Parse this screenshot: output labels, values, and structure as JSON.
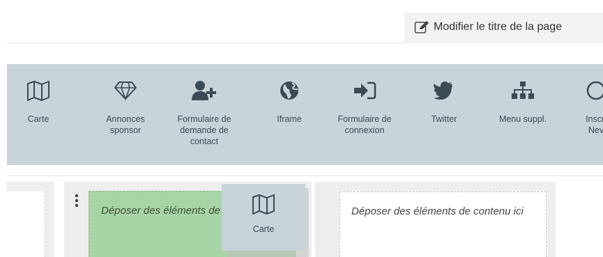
{
  "header": {
    "edit_title_label": "Modifier le titre de la page",
    "edit_icon": "edit-icon"
  },
  "widgets": [
    {
      "label": "Carte",
      "icon": "map-icon"
    },
    {
      "label": "Annonces sponsor",
      "icon": "diamond-icon"
    },
    {
      "label": "Formulaire de demande de contact",
      "icon": "user-plus-icon"
    },
    {
      "label": "Iframe",
      "icon": "globe-icon"
    },
    {
      "label": "Formulaire de connexion",
      "icon": "sign-in-icon"
    },
    {
      "label": "Twitter",
      "icon": "twitter-icon"
    },
    {
      "label": "Menu suppl.",
      "icon": "sitemap-icon"
    },
    {
      "label": "Inscri Nev",
      "icon": "newsletter-icon"
    }
  ],
  "content": {
    "drop_zone_text": "Déposer des éléments de contenu ici",
    "drop_zone_active_text": "Déposer des éléments de contenu ici",
    "drag_ghost_label": "Carte"
  },
  "colors": {
    "toolbar_bg": "#c8d3da",
    "drop_active_bg": "#a8d5a5",
    "icon_color": "#3c4a55"
  }
}
